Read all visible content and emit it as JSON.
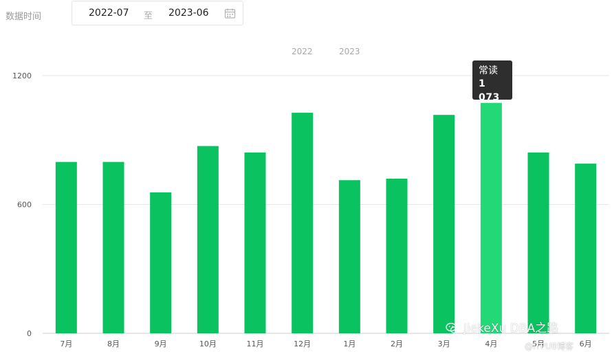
{
  "filter": {
    "label": "数据时间",
    "start": "2022-07",
    "separator": "至",
    "end": "2023-06",
    "calendar_icon": "calendar-icon"
  },
  "year_tags": [
    "2022",
    "2023"
  ],
  "tooltip": {
    "name": "常读",
    "value": "1 073"
  },
  "watermark": {
    "line1": "JiekeXu DBA之路",
    "line2": "@ITPUB博客",
    "logo_icon": "wechat-icon"
  },
  "colors": {
    "bar": "#0ac25f",
    "bar_highlight": "#22d877",
    "gridline": "#e6e6e6",
    "axis": "#cccccc"
  },
  "chart_data": {
    "type": "bar",
    "categories": [
      "7月",
      "8月",
      "9月",
      "10月",
      "11月",
      "12月",
      "1月",
      "2月",
      "3月",
      "4月",
      "5月",
      "6月"
    ],
    "values": [
      798,
      798,
      656,
      872,
      842,
      1027,
      713,
      720,
      1017,
      1073,
      842,
      790
    ],
    "highlight_index": 9,
    "yticks": [
      0,
      600,
      1200
    ],
    "ylim": [
      0,
      1200
    ],
    "grid": true,
    "title": "",
    "xlabel": "",
    "ylabel": ""
  }
}
